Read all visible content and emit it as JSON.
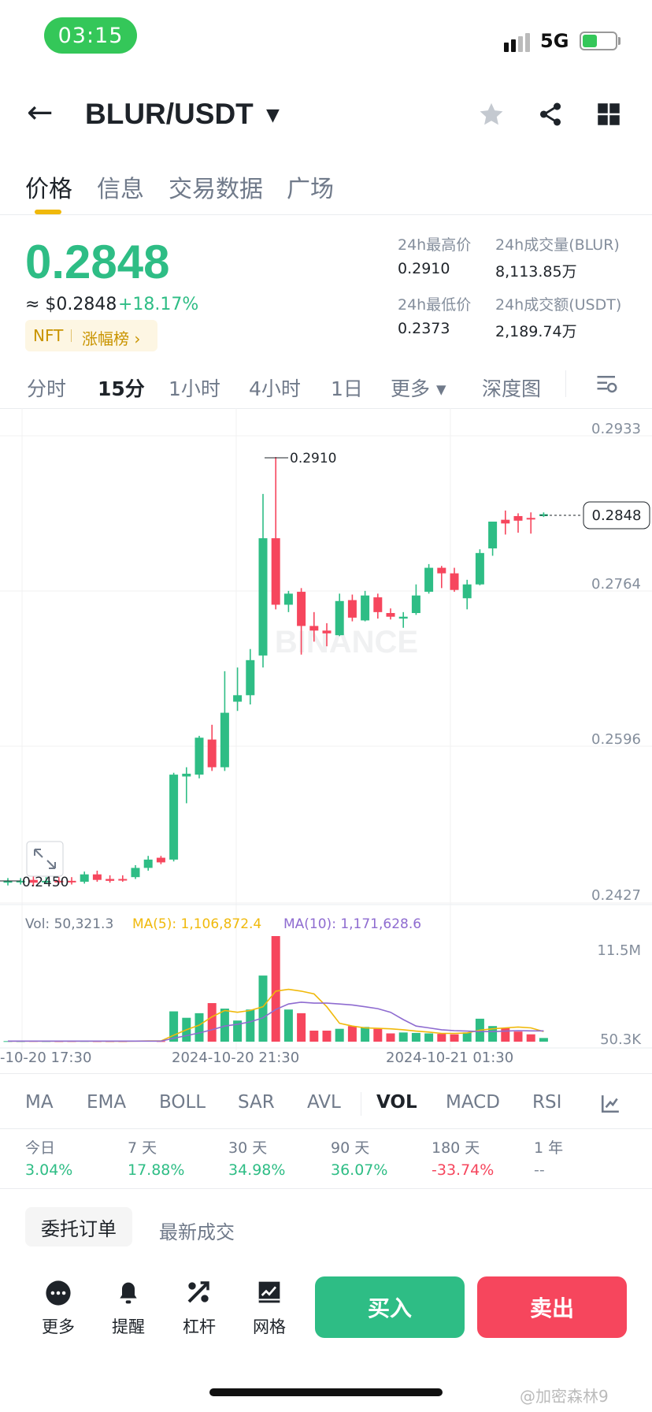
{
  "status_bar": {
    "time": "03:15",
    "network": "5G"
  },
  "header": {
    "pair": "BLUR/USDT"
  },
  "tabs": [
    {
      "label": "价格",
      "active": true
    },
    {
      "label": "信息",
      "active": false
    },
    {
      "label": "交易数据",
      "active": false
    },
    {
      "label": "广场",
      "active": false
    }
  ],
  "price": {
    "last": "0.2848",
    "usd": "≈ $0.2848",
    "change": "+18.17%",
    "tag_category": "NFT",
    "tag_rank": "涨幅榜 ›"
  },
  "stats": {
    "high_label": "24h最高价",
    "high": "0.2910",
    "low_label": "24h最低价",
    "low": "0.2373",
    "vol_blur_label": "24h成交量(BLUR)",
    "vol_blur": "8,113.85万",
    "vol_usdt_label": "24h成交额(USDT)",
    "vol_usdt": "2,189.74万"
  },
  "intervals": [
    {
      "label": "分时",
      "active": false
    },
    {
      "label": "15分",
      "active": true
    },
    {
      "label": "1小时",
      "active": false
    },
    {
      "label": "4小时",
      "active": false
    },
    {
      "label": "1日",
      "active": false
    },
    {
      "label": "更多 ▾",
      "active": false
    },
    {
      "label": "深度图",
      "active": false
    }
  ],
  "chart_data": {
    "type": "candlestick",
    "watermark": "BINANCE",
    "y_ticks": [
      "0.2933",
      "0.2764",
      "0.2596",
      "0.2427"
    ],
    "ylim": [
      0.2427,
      0.2933
    ],
    "current_price_label": "0.2848",
    "high_label": "0.2910",
    "low_label": "0.2450",
    "x_ticks": [
      "-10-20 17:30",
      "2024-10-20 21:30",
      "2024-10-21 01:30"
    ],
    "candles": [
      {
        "o": 0.2449,
        "c": 0.2451,
        "h": 0.2454,
        "l": 0.2446
      },
      {
        "o": 0.245,
        "c": 0.2451,
        "h": 0.2454,
        "l": 0.2447
      },
      {
        "o": 0.2452,
        "c": 0.2449,
        "h": 0.2456,
        "l": 0.2445
      },
      {
        "o": 0.245,
        "c": 0.2451,
        "h": 0.2455,
        "l": 0.2448
      },
      {
        "o": 0.2451,
        "c": 0.245,
        "h": 0.2455,
        "l": 0.2448
      },
      {
        "o": 0.2451,
        "c": 0.245,
        "h": 0.2455,
        "l": 0.2447
      },
      {
        "o": 0.245,
        "c": 0.2458,
        "h": 0.2461,
        "l": 0.2448
      },
      {
        "o": 0.2458,
        "c": 0.2452,
        "h": 0.2462,
        "l": 0.245
      },
      {
        "o": 0.2453,
        "c": 0.2451,
        "h": 0.2457,
        "l": 0.2449
      },
      {
        "o": 0.2453,
        "c": 0.2452,
        "h": 0.2457,
        "l": 0.245
      },
      {
        "o": 0.2455,
        "c": 0.2465,
        "h": 0.2468,
        "l": 0.2453
      },
      {
        "o": 0.2465,
        "c": 0.2474,
        "h": 0.2478,
        "l": 0.2462
      },
      {
        "o": 0.2476,
        "c": 0.2471,
        "h": 0.2478,
        "l": 0.2469
      },
      {
        "o": 0.2474,
        "c": 0.2566,
        "h": 0.2568,
        "l": 0.2472
      },
      {
        "o": 0.2564,
        "c": 0.2567,
        "h": 0.2574,
        "l": 0.2535
      },
      {
        "o": 0.2566,
        "c": 0.2606,
        "h": 0.2608,
        "l": 0.2562
      },
      {
        "o": 0.2604,
        "c": 0.2574,
        "h": 0.262,
        "l": 0.257
      },
      {
        "o": 0.2574,
        "c": 0.2633,
        "h": 0.2678,
        "l": 0.257
      },
      {
        "o": 0.2645,
        "c": 0.2652,
        "h": 0.2682,
        "l": 0.2635
      },
      {
        "o": 0.2652,
        "c": 0.269,
        "h": 0.2702,
        "l": 0.2642
      },
      {
        "o": 0.2695,
        "c": 0.2822,
        "h": 0.287,
        "l": 0.2682
      },
      {
        "o": 0.2822,
        "c": 0.275,
        "h": 0.291,
        "l": 0.2745
      },
      {
        "o": 0.275,
        "c": 0.2762,
        "h": 0.2765,
        "l": 0.2742
      },
      {
        "o": 0.2764,
        "c": 0.2727,
        "h": 0.2768,
        "l": 0.2696
      },
      {
        "o": 0.2727,
        "c": 0.2722,
        "h": 0.2742,
        "l": 0.271
      },
      {
        "o": 0.2722,
        "c": 0.2719,
        "h": 0.273,
        "l": 0.2705
      },
      {
        "o": 0.2717,
        "c": 0.2754,
        "h": 0.2762,
        "l": 0.2716
      },
      {
        "o": 0.2755,
        "c": 0.2736,
        "h": 0.2761,
        "l": 0.2732
      },
      {
        "o": 0.2733,
        "c": 0.276,
        "h": 0.2765,
        "l": 0.2732
      },
      {
        "o": 0.2758,
        "c": 0.2742,
        "h": 0.2762,
        "l": 0.2735
      },
      {
        "o": 0.2741,
        "c": 0.2737,
        "h": 0.2746,
        "l": 0.2734
      },
      {
        "o": 0.2735,
        "c": 0.2737,
        "h": 0.2742,
        "l": 0.2725
      },
      {
        "o": 0.2741,
        "c": 0.276,
        "h": 0.2772,
        "l": 0.2739
      },
      {
        "o": 0.2764,
        "c": 0.279,
        "h": 0.2794,
        "l": 0.2762
      },
      {
        "o": 0.279,
        "c": 0.2784,
        "h": 0.2792,
        "l": 0.2768
      },
      {
        "o": 0.2784,
        "c": 0.2766,
        "h": 0.279,
        "l": 0.2764
      },
      {
        "o": 0.2757,
        "c": 0.2772,
        "h": 0.2777,
        "l": 0.2745
      },
      {
        "o": 0.2772,
        "c": 0.2806,
        "h": 0.281,
        "l": 0.2771
      },
      {
        "o": 0.2811,
        "c": 0.284,
        "h": 0.284,
        "l": 0.2803
      },
      {
        "o": 0.2842,
        "c": 0.2838,
        "h": 0.2852,
        "l": 0.2826
      },
      {
        "o": 0.2846,
        "c": 0.2841,
        "h": 0.2849,
        "l": 0.2828
      },
      {
        "o": 0.2844,
        "c": 0.2843,
        "h": 0.285,
        "l": 0.2827
      },
      {
        "o": 0.2846,
        "c": 0.2848,
        "h": 0.285,
        "l": 0.2845
      }
    ],
    "volume": {
      "current_label": "Vol: 50,321.3",
      "ma5_label": "MA(5): 1,106,872.4",
      "ma10_label": "MA(10): 1,171,628.6",
      "ma5_color": "#f0b90b",
      "ma10_color": "#8e6bd0",
      "y_ticks": [
        "11.5M",
        "50.3K"
      ],
      "ylim": [
        50300,
        11500000
      ],
      "bars": [
        60000,
        55000,
        70000,
        60000,
        50000,
        58000,
        70000,
        50000,
        45000,
        48000,
        90000,
        120000,
        60000,
        3300000,
        2600000,
        3100000,
        4200000,
        3600000,
        2300000,
        3500000,
        7200000,
        11500000,
        3500000,
        3100000,
        1200000,
        1200000,
        1400000,
        1700000,
        1600000,
        1400000,
        900000,
        1000000,
        950000,
        900000,
        850000,
        800000,
        1000000,
        2500000,
        1700000,
        1500000,
        1100000,
        800000,
        400000
      ],
      "ma5": [
        60000,
        58000,
        60000,
        60000,
        58000,
        60000,
        62000,
        58000,
        55000,
        55000,
        62000,
        75000,
        75000,
        700000,
        1300000,
        1800000,
        2700000,
        3400000,
        3200000,
        3400000,
        3800000,
        5500000,
        5700000,
        5500000,
        5200000,
        3800000,
        2000000,
        1700000,
        1500000,
        1450000,
        1400000,
        1300000,
        1150000,
        1050000,
        900000,
        900000,
        950000,
        1250000,
        1400000,
        1500000,
        1600000,
        1500000,
        1106872
      ],
      "ma10": [
        60000,
        58000,
        60000,
        60000,
        58000,
        60000,
        60000,
        59000,
        58000,
        57000,
        57000,
        60000,
        62000,
        380000,
        650000,
        950000,
        1300000,
        1700000,
        1900000,
        2150000,
        2600000,
        3500000,
        4100000,
        4300000,
        4200000,
        4200000,
        4100000,
        4000000,
        3800000,
        3600000,
        3200000,
        2400000,
        1700000,
        1500000,
        1300000,
        1200000,
        1150000,
        1100000,
        1100000,
        1150000,
        1200000,
        1180000,
        1171628
      ]
    }
  },
  "indicators": [
    {
      "label": "MA",
      "active": false
    },
    {
      "label": "EMA",
      "active": false
    },
    {
      "label": "BOLL",
      "active": false
    },
    {
      "label": "SAR",
      "active": false
    },
    {
      "label": "AVL",
      "active": false
    },
    {
      "label": "VOL",
      "active": true
    },
    {
      "label": "MACD",
      "active": false
    },
    {
      "label": "RSI",
      "active": false
    }
  ],
  "performance": [
    {
      "label": "今日",
      "value": "3.04%",
      "color": "#2ebd85"
    },
    {
      "label": "7 天",
      "value": "17.88%",
      "color": "#2ebd85"
    },
    {
      "label": "30 天",
      "value": "34.98%",
      "color": "#2ebd85"
    },
    {
      "label": "90 天",
      "value": "36.07%",
      "color": "#2ebd85"
    },
    {
      "label": "180 天",
      "value": "-33.74%",
      "color": "#f6465d"
    },
    {
      "label": "1 年",
      "value": "--",
      "color": "#848e9c"
    }
  ],
  "order_tabs": {
    "open_orders": "委托订单",
    "latest_trades": "最新成交"
  },
  "bottom_bar": {
    "more": "更多",
    "alert": "提醒",
    "leverage": "杠杆",
    "grid": "网格",
    "buy": "买入",
    "sell": "卖出"
  },
  "watermark_text": "@加密森林9",
  "colors": {
    "up": "#2ebd85",
    "down": "#f6465d",
    "accent": "#f0b90b"
  }
}
